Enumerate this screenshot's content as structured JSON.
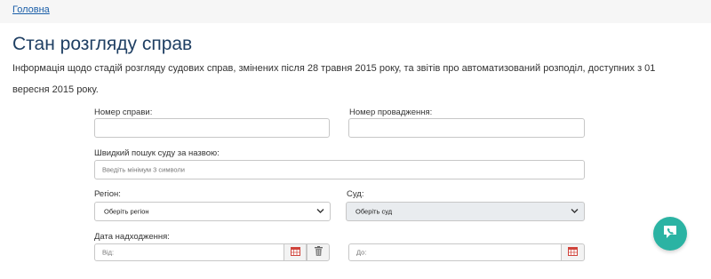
{
  "breadcrumb": {
    "home": "Головна"
  },
  "page": {
    "title": "Стан розгляду справ",
    "description": "Інформація щодо стадій розгляду судових справ, змінених після 28 травня 2015 року, та звітів про автоматизований розподіл, доступних з 01 вересня 2015 року."
  },
  "form": {
    "case_number_label": "Номер справи:",
    "case_number_value": "",
    "proceeding_number_label": "Номер провадження:",
    "proceeding_number_value": "",
    "court_search_label": "Швидкий пошук суду за назвою:",
    "court_search_placeholder": "Введіть мінімум 3 символи",
    "region_label": "Регіон:",
    "region_selected": "Оберіть регіон",
    "court_label": "Суд:",
    "court_selected": "Оберіть суд",
    "date_label": "Дата надходження:",
    "date_from_placeholder": "Від:",
    "date_to_placeholder": "До:"
  },
  "icons": {
    "calendar": "calendar-icon",
    "trash": "trash-icon",
    "chevron": "chevron-down-icon",
    "chat": "chat-icon"
  },
  "colors": {
    "link": "#1a5ea8",
    "title": "#1f3f63",
    "chat_button": "#2bb3a3",
    "calendar_red": "#d0443c"
  }
}
